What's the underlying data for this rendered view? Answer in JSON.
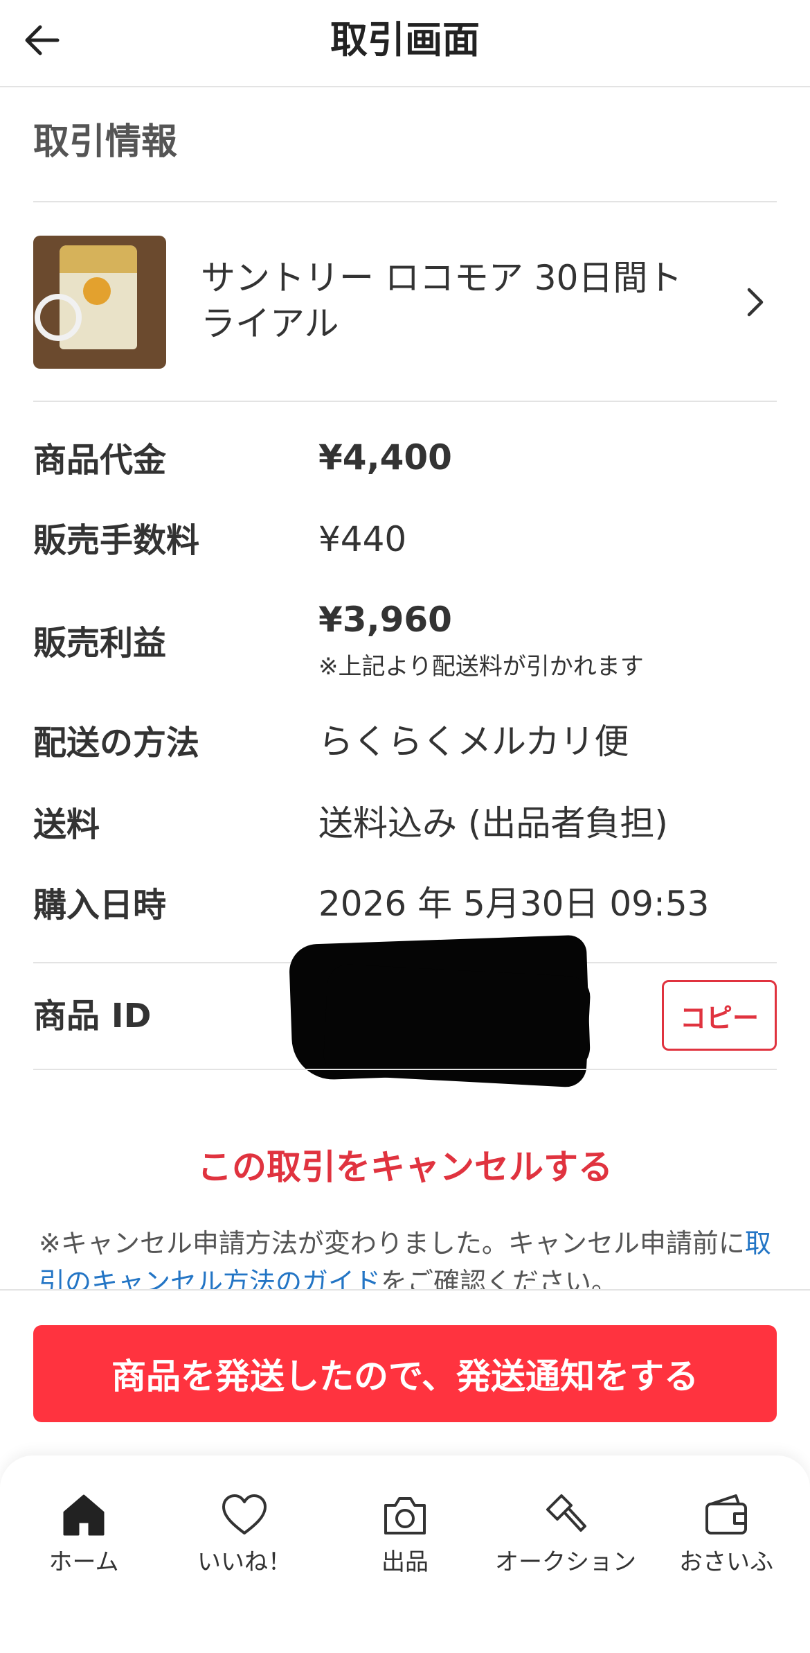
{
  "header": {
    "title": "取引画面",
    "back_icon": "arrow-left-icon"
  },
  "section_title": "取引情報",
  "item": {
    "name": "サントリー ロコモア 30日間トライアル",
    "chevron_icon": "chevron-right-icon"
  },
  "info": {
    "price_label": "商品代金",
    "price_value": "¥4,400",
    "fee_label": "販売手数料",
    "fee_value": "¥440",
    "profit_label": "販売利益",
    "profit_value": "¥3,960",
    "profit_note": "※上記より配送料が引かれます",
    "shipping_method_label": "配送の方法",
    "shipping_method_value": "らくらくメルカリ便",
    "shipping_fee_label": "送料",
    "shipping_fee_value": "送料込み (出品者負担)",
    "purchase_date_label": "購入日時",
    "purchase_date_value": "2026 年 5月30日 09:53",
    "item_id_label": "商品 ID",
    "copy_label": "コピー"
  },
  "cancel": {
    "link": "この取引をキャンセルする",
    "note_prefix": "※キャンセル申請方法が変わりました。キャンセル申請前に",
    "guide_link": "取引のキャンセル方法のガイド",
    "note_suffix": "をご確認ください。"
  },
  "primary_button": "商品を発送したので、発送通知をする",
  "colors": {
    "accent": "#ff333f",
    "link": "#2375c5",
    "cancel_red": "#e0333f"
  },
  "tabbar": [
    {
      "label": "ホーム",
      "icon": "home-icon"
    },
    {
      "label": "いいね！",
      "icon": "heart-icon"
    },
    {
      "label": "出品",
      "icon": "camera-icon"
    },
    {
      "label": "オークション",
      "icon": "gavel-icon"
    },
    {
      "label": "おさいふ",
      "icon": "wallet-icon"
    }
  ]
}
